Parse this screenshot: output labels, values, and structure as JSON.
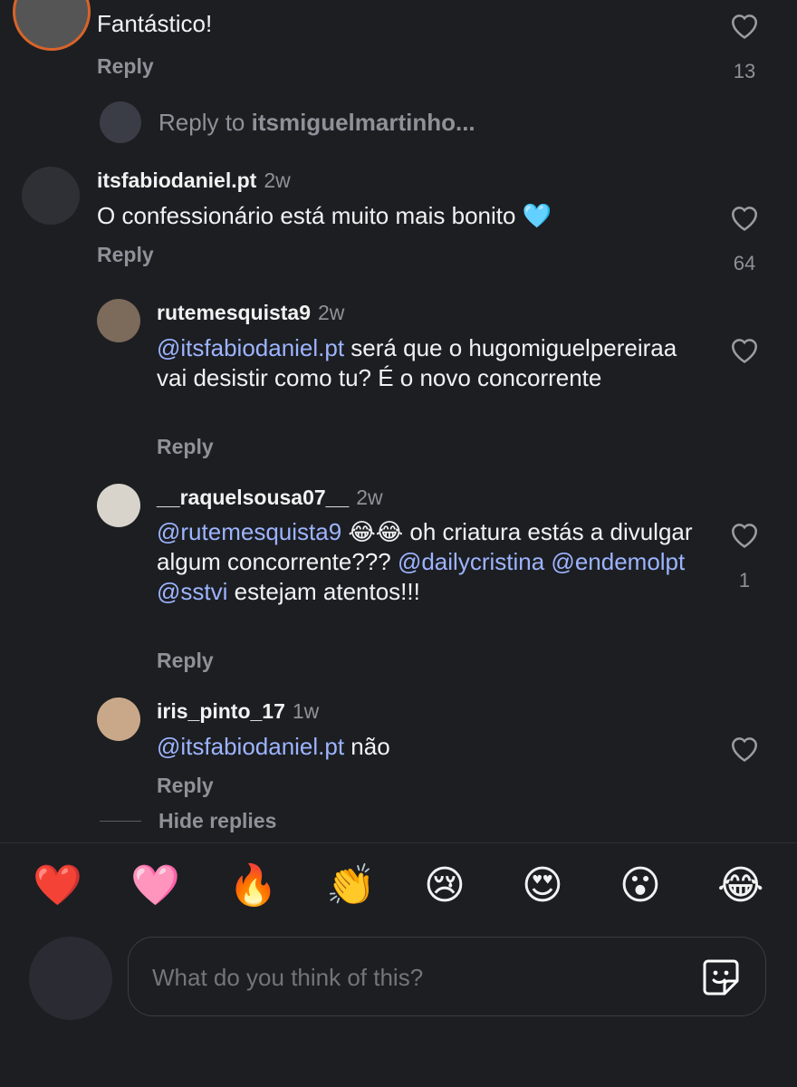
{
  "colors": {
    "background": "#1c1e22",
    "mention": "#9db4ff",
    "muted": "#8e9298"
  },
  "top_comment": {
    "text": "Fantástico!",
    "reply_label": "Reply",
    "likes": "13"
  },
  "reply_to": {
    "label": "Reply to",
    "user": "itsmiguelmartinho..."
  },
  "comments": [
    {
      "username": "itsfabiodaniel.pt",
      "time": "2w",
      "text": "O confessionário está muito mais bonito 🩵",
      "reply_label": "Reply",
      "likes": "64"
    },
    {
      "username": "rutemesquista9",
      "time": "2w",
      "mention": "@itsfabiodaniel.pt",
      "text": " será que o hugomiguelpereiraa vai desistir como tu? É o novo concorrente",
      "reply_label": "Reply",
      "likes": ""
    },
    {
      "username": "__raquelsousa07__",
      "time": "2w",
      "mention1": "@rutemesquista9",
      "text1": " 😂😂 oh criatura estás a divulgar algum concorrente??? ",
      "mention2": "@dailycristina",
      "mention3": "@endemolpt",
      "mention4": "@sstvi",
      "text2": " estejam atentos!!!",
      "reply_label": "Reply",
      "likes": "1"
    },
    {
      "username": "iris_pinto_17",
      "time": "1w",
      "mention": "@itsfabiodaniel.pt",
      "text": " não",
      "reply_label": "Reply",
      "likes": ""
    }
  ],
  "hide_replies": "Hide replies",
  "reactions": [
    "❤️",
    "🩷",
    "🔥",
    "👏",
    "😢",
    "😍",
    "😮",
    "😂"
  ],
  "composer": {
    "placeholder": "What do you think of this?",
    "sticker_icon": "sticker-icon"
  }
}
